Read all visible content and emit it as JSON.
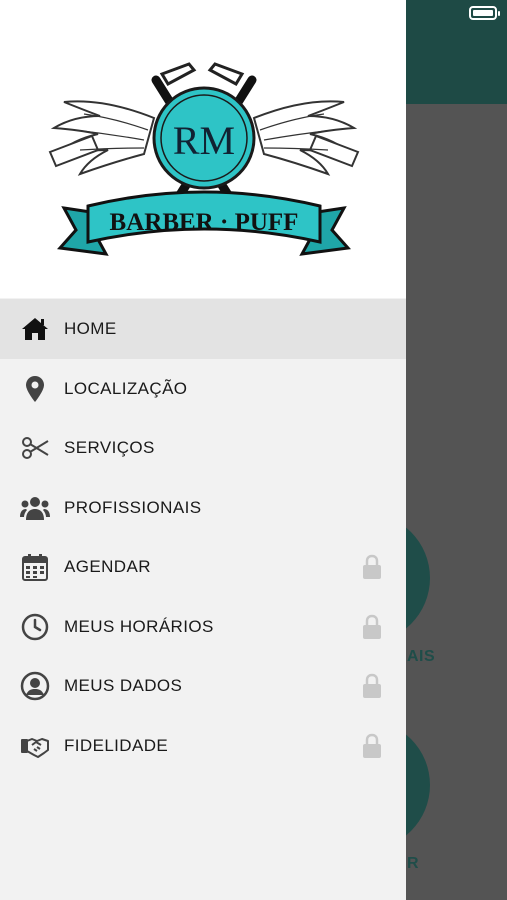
{
  "status_bar": {
    "battery_icon": "battery-icon"
  },
  "background": {
    "header_color": "#1e4a45",
    "items": [
      {
        "label": "AIS"
      },
      {
        "label": "R"
      }
    ]
  },
  "drawer": {
    "logo": {
      "monogram": "RM",
      "banner_text": "BARBER · PUFF",
      "accent_color": "#2ec4c6"
    },
    "menu": [
      {
        "label": "HOME",
        "icon": "home-icon",
        "active": true,
        "locked": false
      },
      {
        "label": "LOCALIZAÇÃO",
        "icon": "map-pin-icon",
        "active": false,
        "locked": false
      },
      {
        "label": "SERVIÇOS",
        "icon": "scissors-icon",
        "active": false,
        "locked": false
      },
      {
        "label": "PROFISSIONAIS",
        "icon": "users-icon",
        "active": false,
        "locked": false
      },
      {
        "label": "AGENDAR",
        "icon": "calendar-icon",
        "active": false,
        "locked": true
      },
      {
        "label": "MEUS HORÁRIOS",
        "icon": "clock-icon",
        "active": false,
        "locked": true
      },
      {
        "label": "MEUS DADOS",
        "icon": "user-circle-icon",
        "active": false,
        "locked": true
      },
      {
        "label": "FIDELIDADE",
        "icon": "handshake-icon",
        "active": false,
        "locked": true
      }
    ]
  }
}
